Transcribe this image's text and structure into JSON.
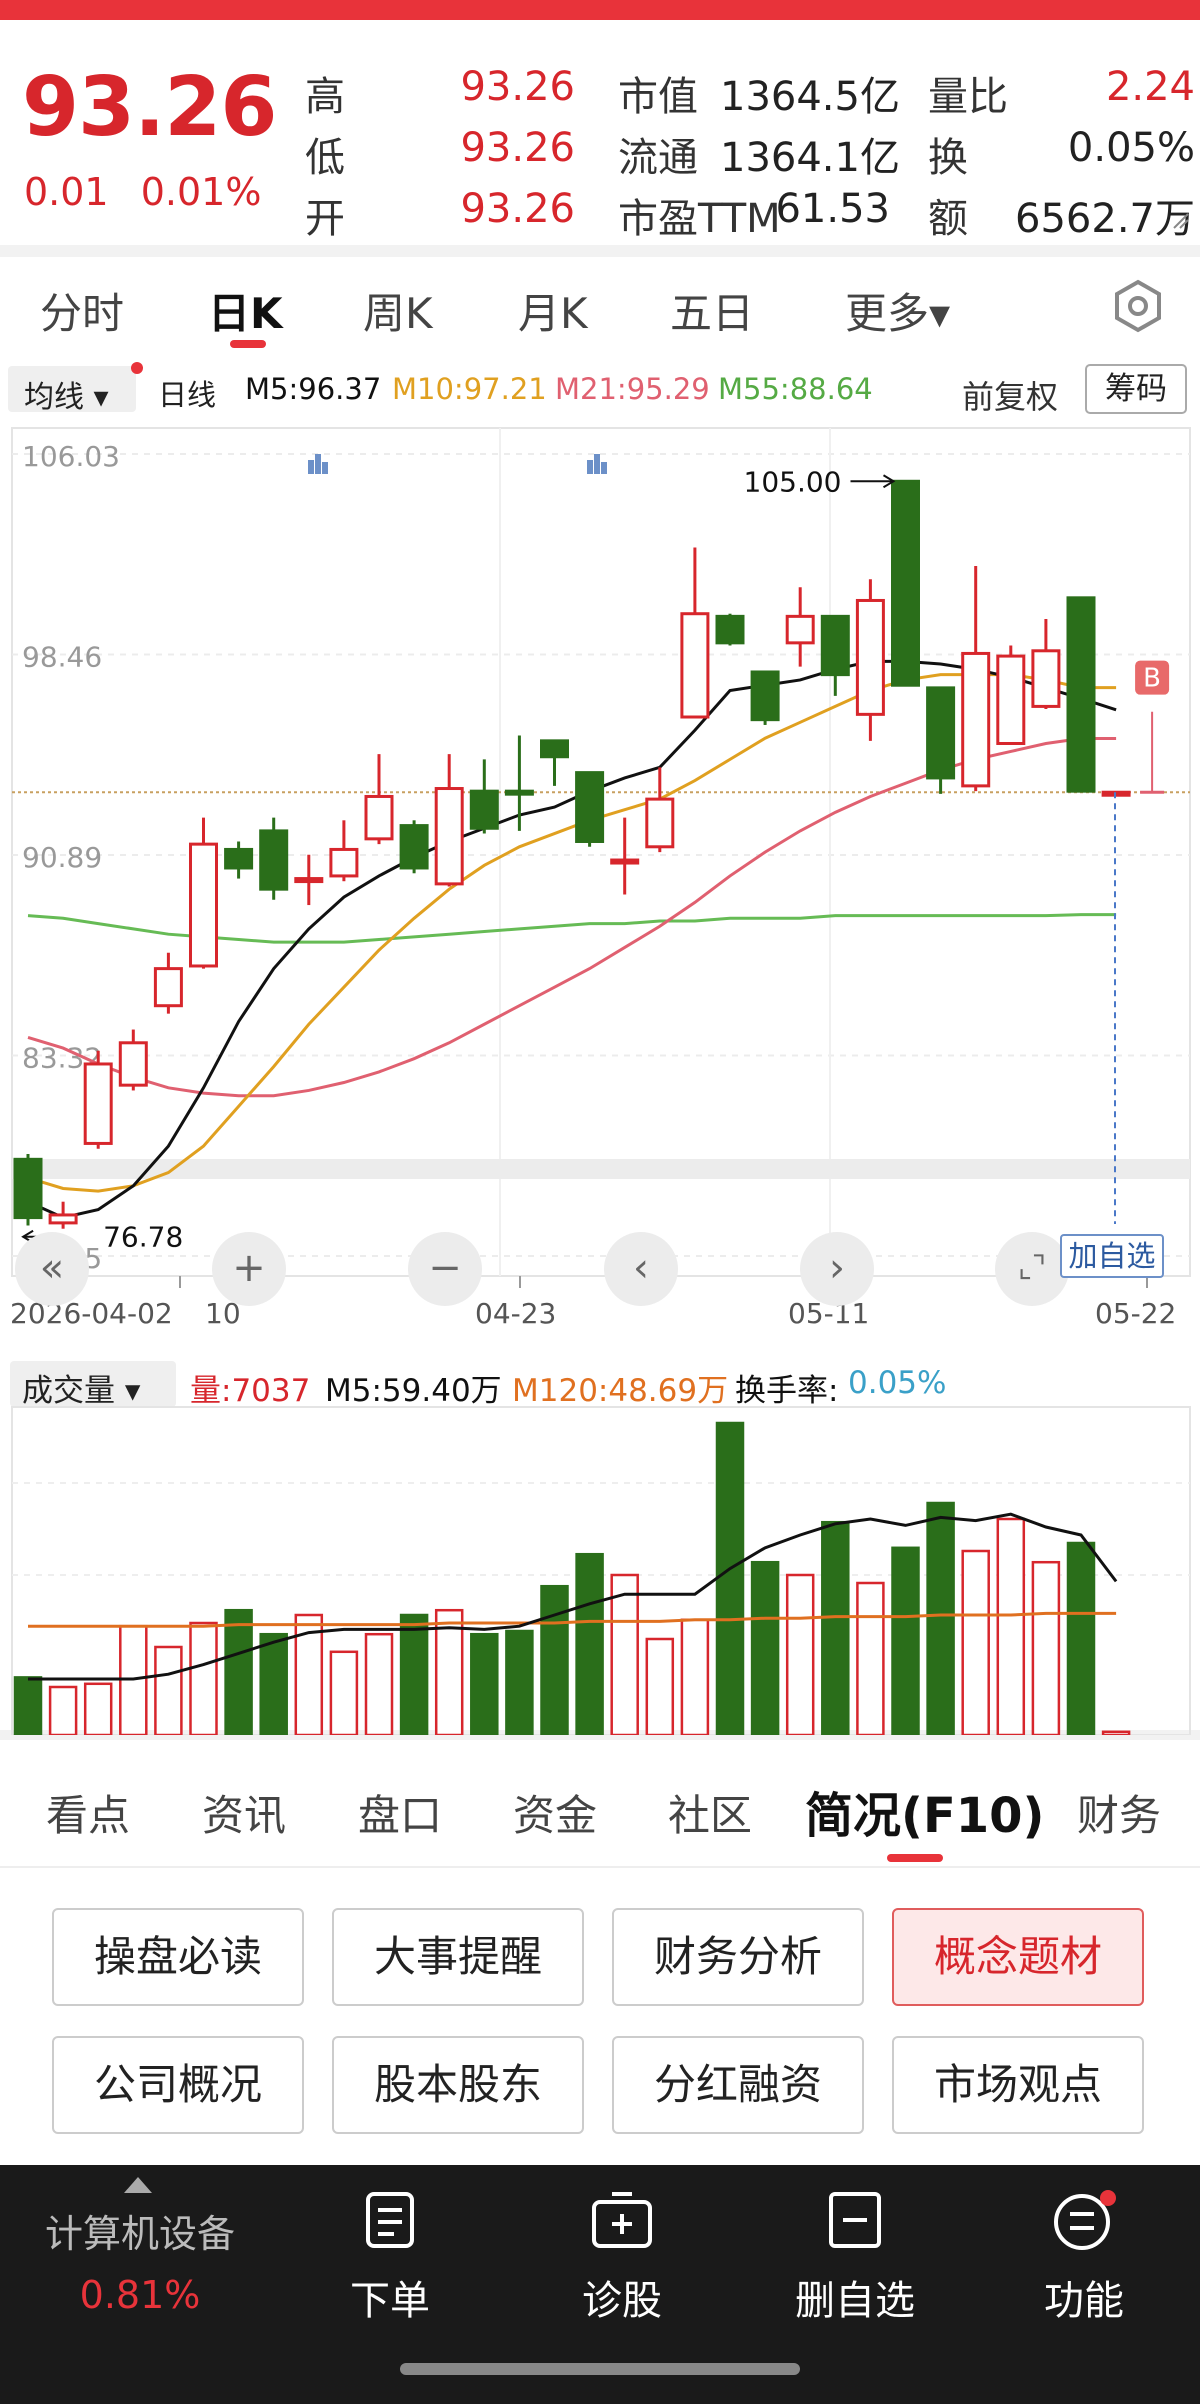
{
  "quote": {
    "price": "93.26",
    "change": "0.01",
    "change_pct": "0.01%",
    "rows": [
      {
        "l1": "高",
        "v1": "93.26",
        "l2": "市值",
        "v2": "1364.5亿",
        "l3": "量比",
        "v3": "2.24"
      },
      {
        "l1": "低",
        "v1": "93.26",
        "l2": "流通",
        "v2": "1364.1亿",
        "l3": "换",
        "v3": "0.05%"
      },
      {
        "l1": "开",
        "v1": "93.26",
        "l2": "市盈TTM",
        "v2": "61.53",
        "l3": "额",
        "v3": "6562.7万"
      }
    ]
  },
  "period_tabs": [
    "分时",
    "日K",
    "周K",
    "月K",
    "五日",
    "更多▾"
  ],
  "active_period": "日K",
  "ma_bar": {
    "selector": "均线 ▾",
    "period": "日线",
    "m5": "M5:96.37",
    "m10": "M10:97.21",
    "m21": "M21:95.29",
    "m55": "M55:88.64",
    "adjust": "前复权",
    "chip_button": "筹码"
  },
  "colors": {
    "up": "#d7262c",
    "down": "#2a6e1a",
    "ma5": "#111111",
    "ma10": "#e0a020",
    "ma21": "#e06070",
    "ma55": "#66bb55",
    "accent": "#e8333a"
  },
  "chart_data": {
    "type": "candlestick",
    "ylabels": [
      "106.03",
      "98.46",
      "90.89",
      "83.32",
      "75.75"
    ],
    "ylim": [
      75.75,
      106.03
    ],
    "high_annotation": "105.00",
    "low_annotation": "76.78",
    "x_labels": [
      "2026-04-02",
      "10",
      "04-23",
      "05-11",
      "05-22"
    ],
    "candles": [
      {
        "o": 79.4,
        "c": 77.2,
        "h": 79.6,
        "l": 76.9
      },
      {
        "o": 77.0,
        "c": 77.3,
        "h": 77.8,
        "l": 76.78
      },
      {
        "o": 80.0,
        "c": 83.0,
        "h": 83.5,
        "l": 79.8
      },
      {
        "o": 82.2,
        "c": 83.8,
        "h": 84.3,
        "l": 82.0
      },
      {
        "o": 85.2,
        "c": 86.6,
        "h": 87.2,
        "l": 84.9
      },
      {
        "o": 86.7,
        "c": 91.3,
        "h": 92.3,
        "l": 86.6
      },
      {
        "o": 91.1,
        "c": 90.4,
        "h": 91.4,
        "l": 90.0
      },
      {
        "o": 91.8,
        "c": 89.6,
        "h": 92.3,
        "l": 89.2
      },
      {
        "o": 89.9,
        "c": 90.0,
        "h": 90.9,
        "l": 89.0
      },
      {
        "o": 90.1,
        "c": 91.1,
        "h": 92.2,
        "l": 89.9
      },
      {
        "o": 91.5,
        "c": 93.1,
        "h": 94.7,
        "l": 91.3
      },
      {
        "o": 92.0,
        "c": 90.4,
        "h": 92.2,
        "l": 90.2
      },
      {
        "o": 89.8,
        "c": 93.4,
        "h": 94.7,
        "l": 89.7
      },
      {
        "o": 93.3,
        "c": 91.9,
        "h": 94.5,
        "l": 91.7
      },
      {
        "o": 93.3,
        "c": 93.2,
        "h": 95.4,
        "l": 91.8
      },
      {
        "o": 95.2,
        "c": 94.6,
        "h": 95.2,
        "l": 93.5
      },
      {
        "o": 94.0,
        "c": 91.4,
        "h": 94.0,
        "l": 91.2
      },
      {
        "o": 90.6,
        "c": 90.7,
        "h": 92.3,
        "l": 89.4
      },
      {
        "o": 91.2,
        "c": 93.0,
        "h": 94.2,
        "l": 91.0
      },
      {
        "o": 96.1,
        "c": 100.0,
        "h": 102.5,
        "l": 96.1
      },
      {
        "o": 99.9,
        "c": 98.9,
        "h": 100.0,
        "l": 98.8
      },
      {
        "o": 97.8,
        "c": 96.0,
        "h": 97.8,
        "l": 95.8
      },
      {
        "o": 98.9,
        "c": 99.9,
        "h": 101.0,
        "l": 98.0
      },
      {
        "o": 99.9,
        "c": 97.7,
        "h": 99.9,
        "l": 96.9
      },
      {
        "o": 96.2,
        "c": 100.5,
        "h": 101.3,
        "l": 95.2
      },
      {
        "o": 105.0,
        "c": 97.3,
        "h": 105.0,
        "l": 97.3
      },
      {
        "o": 97.2,
        "c": 93.8,
        "h": 97.2,
        "l": 93.2
      },
      {
        "o": 93.5,
        "c": 98.5,
        "h": 101.8,
        "l": 93.3
      },
      {
        "o": 95.1,
        "c": 98.4,
        "h": 98.8,
        "l": 95.2
      },
      {
        "o": 96.5,
        "c": 98.6,
        "h": 99.8,
        "l": 96.4
      },
      {
        "o": 100.6,
        "c": 93.3,
        "h": 100.6,
        "l": 93.3
      },
      {
        "o": 93.25,
        "c": 93.26,
        "h": 93.26,
        "l": 93.25
      }
    ],
    "ma5": [
      77.8,
      77.2,
      77.5,
      78.4,
      79.9,
      82.1,
      84.6,
      86.6,
      88.1,
      89.3,
      90.1,
      90.8,
      91.4,
      91.9,
      92.4,
      92.7,
      93.3,
      93.8,
      94.2,
      95.6,
      97.1,
      97.3,
      97.5,
      97.9,
      98.2,
      98.2,
      98.1,
      97.9,
      97.6,
      97.2,
      96.8,
      96.37
    ],
    "ma10": [
      78.7,
      78.3,
      78.2,
      78.4,
      78.9,
      79.9,
      81.4,
      82.9,
      84.5,
      85.9,
      87.3,
      88.5,
      89.6,
      90.5,
      91.2,
      91.7,
      92.2,
      92.6,
      93.0,
      93.7,
      94.5,
      95.3,
      95.9,
      96.5,
      97.1,
      97.5,
      97.7,
      97.7,
      97.7,
      97.5,
      97.21,
      97.21
    ],
    "ma21": [
      84.0,
      83.6,
      83.0,
      82.5,
      82.1,
      81.9,
      81.8,
      81.8,
      82.0,
      82.3,
      82.7,
      83.2,
      83.8,
      84.5,
      85.2,
      85.9,
      86.6,
      87.4,
      88.2,
      89.1,
      90.1,
      91.0,
      91.8,
      92.5,
      93.1,
      93.6,
      94.1,
      94.5,
      94.8,
      95.1,
      95.29,
      95.29
    ],
    "ma55": [
      88.6,
      88.5,
      88.3,
      88.1,
      87.9,
      87.8,
      87.7,
      87.6,
      87.6,
      87.6,
      87.7,
      87.8,
      87.9,
      88.0,
      88.1,
      88.2,
      88.3,
      88.3,
      88.4,
      88.4,
      88.5,
      88.5,
      88.5,
      88.6,
      88.6,
      88.6,
      88.6,
      88.6,
      88.6,
      88.6,
      88.64,
      88.64
    ]
  },
  "controls": {
    "add_watch": "加自选",
    "b_marker": "B"
  },
  "volume_bar": {
    "selector": "成交量 ▾",
    "vol": "量:7037",
    "m5": "M5:59.40万",
    "m120": "M120:48.69万",
    "turnover_label": "换手率:",
    "turnover": "0.05%"
  },
  "volume_data": {
    "values": [
      36,
      30,
      32,
      68,
      55,
      70,
      78,
      63,
      75,
      52,
      63,
      75,
      78,
      63,
      65,
      93,
      113,
      100,
      60,
      72,
      195,
      108,
      100,
      133,
      95,
      117,
      145,
      115,
      135,
      108,
      120,
      2
    ],
    "ma5": [
      35,
      35,
      35,
      35,
      38,
      44,
      51,
      58,
      64,
      66,
      66,
      66,
      67,
      66,
      68,
      75,
      82,
      88,
      88,
      88,
      104,
      117,
      125,
      132,
      135,
      131,
      136,
      134,
      138,
      130,
      125,
      96
    ],
    "ma120": [
      68,
      68,
      68,
      68,
      68,
      68,
      69,
      69,
      69,
      69,
      69,
      69,
      70,
      70,
      70,
      70,
      71,
      71,
      71,
      72,
      72,
      73,
      73,
      74,
      74,
      74,
      75,
      75,
      75,
      76,
      76,
      76
    ],
    "ymax": 200
  },
  "bottom_tabs": [
    "看点",
    "资讯",
    "盘口",
    "资金",
    "社区",
    "简况(F10)",
    "财务"
  ],
  "active_bottom_tab": "简况(F10)",
  "f10_buttons": [
    "操盘必读",
    "大事提醒",
    "财务分析",
    "概念题材",
    "公司概况",
    "股本股东",
    "分红融资",
    "市场观点"
  ],
  "highlight_button": "概念题材",
  "footer": {
    "sector_name": "计算机设备",
    "sector_change": "0.81%",
    "items": [
      {
        "label": "下单",
        "icon": "order-icon"
      },
      {
        "label": "诊股",
        "icon": "diagnose-icon"
      },
      {
        "label": "删自选",
        "icon": "remove-watch-icon"
      },
      {
        "label": "功能",
        "icon": "menu-icon"
      }
    ]
  }
}
